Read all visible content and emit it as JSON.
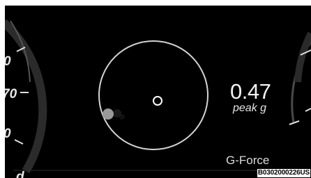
{
  "readout": {
    "peak_value": "0.47",
    "peak_label": "peak g"
  },
  "display": {
    "title": "G-Force"
  },
  "left_gauge": {
    "tick_labels": [
      "0",
      "70",
      "0",
      "d"
    ]
  },
  "image_code": "B0302000226US",
  "colors": {
    "background": "#000000",
    "ring": "#d4d4d4",
    "current_marker": "#9a9a9a",
    "text": "#f2f2f2"
  }
}
